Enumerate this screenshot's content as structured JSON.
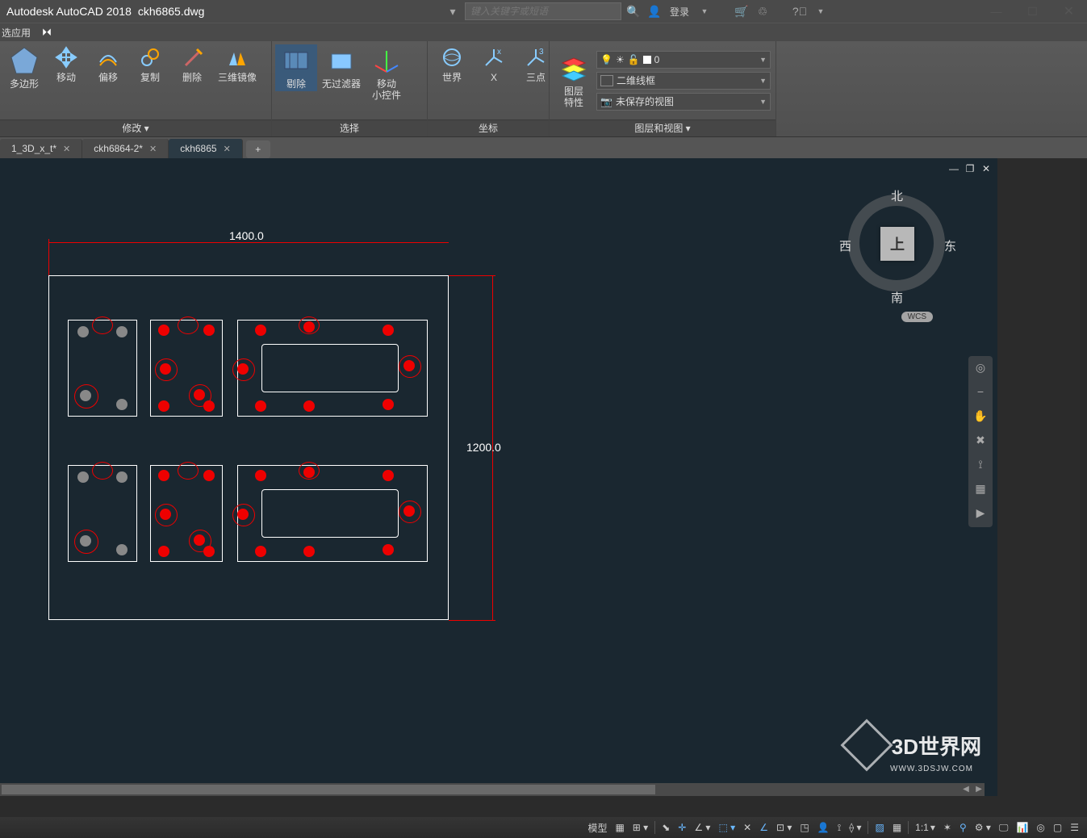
{
  "title": {
    "app": "Autodesk AutoCAD 2018",
    "file": "ckh6865.dwg"
  },
  "search_placeholder": "键入关键字或短语",
  "login": "登录",
  "menubar": {
    "item0": "选应用"
  },
  "ribbon": {
    "panel1": {
      "title": "修改 ▾",
      "btn0": "多边形",
      "btn1": "移动",
      "btn2": "偏移",
      "btn3": "复制",
      "btn4": "删除",
      "btn5": "三维镜像"
    },
    "panel2": {
      "title": "选择",
      "btn0": "剔除",
      "btn1": "无过滤器",
      "btn2": "移动\n小控件"
    },
    "panel3": {
      "title": "坐标",
      "btn0": "世界",
      "btn1": "X",
      "btn2": "三点"
    },
    "panel4": {
      "title": "图层和视图 ▾",
      "label": "图层\n特性",
      "dd0": "0",
      "dd1": "二维线框",
      "dd2": "未保存的视图"
    }
  },
  "tabs": {
    "t0": "1_3D_x_t*",
    "t1": "ckh6864-2*",
    "t2": "ckh6865"
  },
  "viewcube": {
    "face": "上",
    "n": "北",
    "s": "南",
    "w": "西",
    "e": "东",
    "wcs": "WCS"
  },
  "dimensions": {
    "width": "1400.0",
    "height": "1200.0"
  },
  "status": {
    "model": "模型",
    "scale": "1:1"
  },
  "watermark": {
    "main": "3D世界网",
    "sub": "WWW.3DSJW.COM"
  }
}
